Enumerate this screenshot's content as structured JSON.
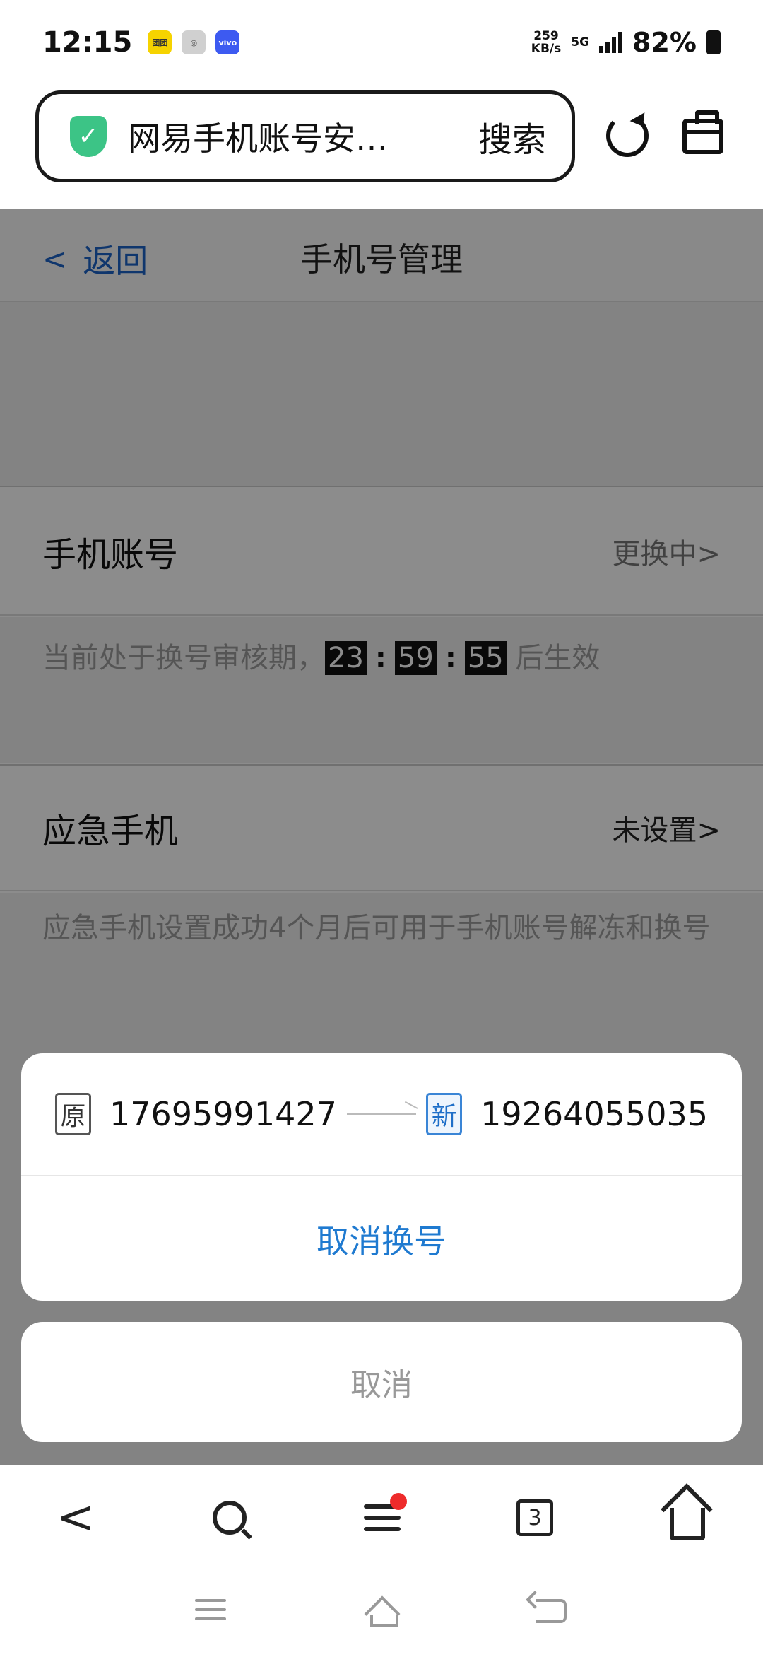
{
  "status_bar": {
    "time": "12:15",
    "apps": [
      "团团",
      "◎",
      "vivo"
    ],
    "net_speed_value": "259",
    "net_speed_unit": "KB/s",
    "network": "5G",
    "battery": "82%"
  },
  "browser": {
    "url_title": "网易手机账号安…",
    "search_label": "搜索"
  },
  "nav": {
    "back_label": "返回",
    "title": "手机号管理"
  },
  "rows": {
    "phone_account_label": "手机账号",
    "phone_account_status": "更换中>",
    "review_prefix": "当前处于换号审核期，",
    "timer_hours": "23",
    "timer_minutes": "59",
    "timer_seconds": "55",
    "review_suffix": "后生效",
    "emergency_label": "应急手机",
    "emergency_status": "未设置>",
    "emergency_note": "应急手机设置成功4个月后可用于手机账号解冻和换号"
  },
  "sheet": {
    "old_tag": "原",
    "old_number": "17695991427",
    "new_tag": "新",
    "new_number": "19264055035",
    "cancel_swap_label": "取消换号",
    "cancel_label": "取消"
  },
  "toolbar": {
    "tab_count": "3"
  },
  "colors": {
    "accent": "#1f7ad0",
    "shield": "#3cc486",
    "notification_dot": "#ee2b2b"
  }
}
